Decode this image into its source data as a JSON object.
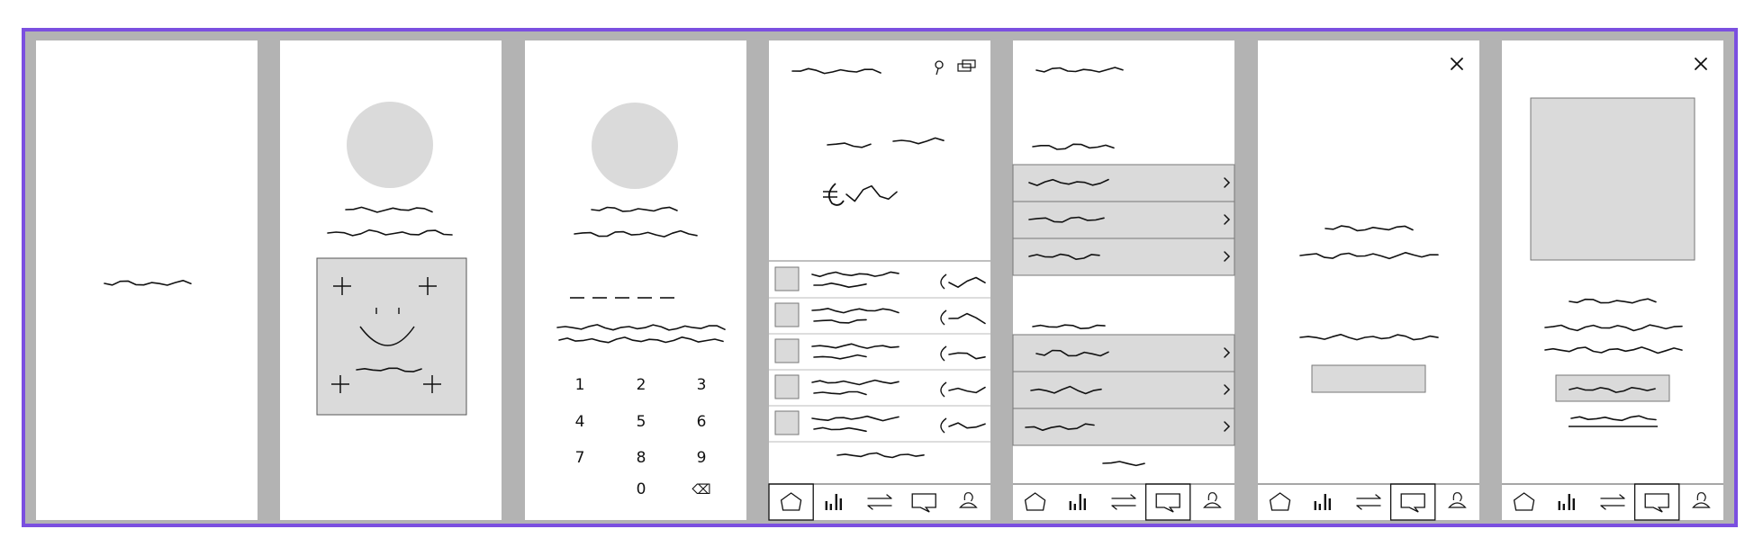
{
  "theme": {
    "frame_border": "#7b4fe0",
    "gutter": "#b3b3b3",
    "screen": "#ffffff",
    "placeholder_fill": "#dadada",
    "stroke": "#111111"
  },
  "screens": [
    {
      "id": "splash",
      "elements": [
        "scribble-text"
      ]
    },
    {
      "id": "face-id",
      "elements": [
        "avatar-placeholder",
        "scribble-text",
        "face-scan-box"
      ]
    },
    {
      "id": "pin-entry",
      "elements": [
        "avatar-placeholder",
        "scribble-text",
        "pin-dashes",
        "number-keypad"
      ]
    },
    {
      "id": "dashboard",
      "elements": [
        "search-icon",
        "cards-icon",
        "balance",
        "transaction-list",
        "tab-bar"
      ]
    },
    {
      "id": "menu",
      "elements": [
        "menu-list",
        "tab-bar"
      ]
    },
    {
      "id": "message-dialog",
      "elements": [
        "close-icon",
        "scribble-text",
        "button",
        "tab-bar"
      ]
    },
    {
      "id": "promo-dialog",
      "elements": [
        "close-icon",
        "image-placeholder",
        "scribble-text",
        "button",
        "link",
        "tab-bar"
      ]
    }
  ],
  "keypad": {
    "keys": [
      "1",
      "2",
      "3",
      "4",
      "5",
      "6",
      "7",
      "8",
      "9",
      "",
      "0",
      "⌫"
    ]
  },
  "transaction_rows": 5,
  "tab_bar": {
    "icons": [
      "home-icon",
      "chart-icon",
      "transfer-icon",
      "chat-icon",
      "profile-icon"
    ],
    "active_by_screen": {
      "dashboard": 0,
      "menu": 3,
      "message-dialog": 3,
      "promo-dialog": 3
    }
  }
}
